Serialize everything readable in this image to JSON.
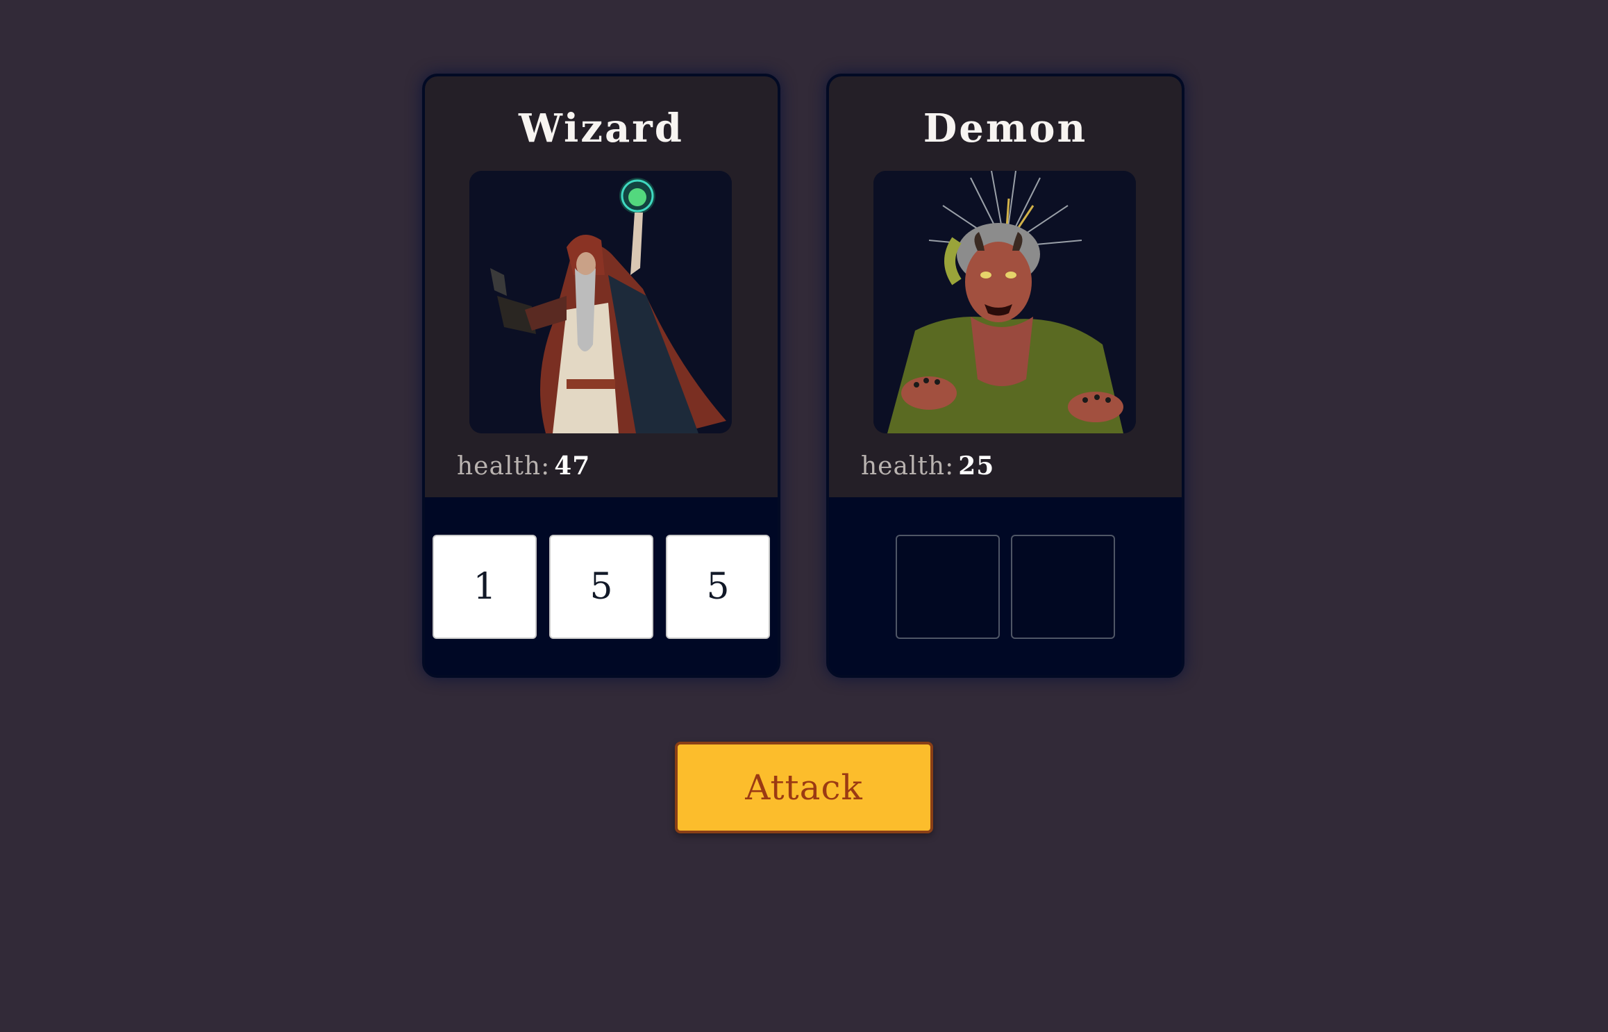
{
  "hero": {
    "name": "Wizard",
    "health_label": "health:",
    "health_value": "47",
    "dice": [
      "1",
      "5",
      "5"
    ]
  },
  "enemy": {
    "name": "Demon",
    "health_label": "health:",
    "health_value": "25",
    "dice": [
      "",
      ""
    ]
  },
  "actions": {
    "attack_label": "Attack"
  },
  "colors": {
    "background": "#322a38",
    "card_top": "#241f27",
    "card_bottom": "#000825",
    "button": "#fcbd2c",
    "button_text": "#9b3a13"
  }
}
